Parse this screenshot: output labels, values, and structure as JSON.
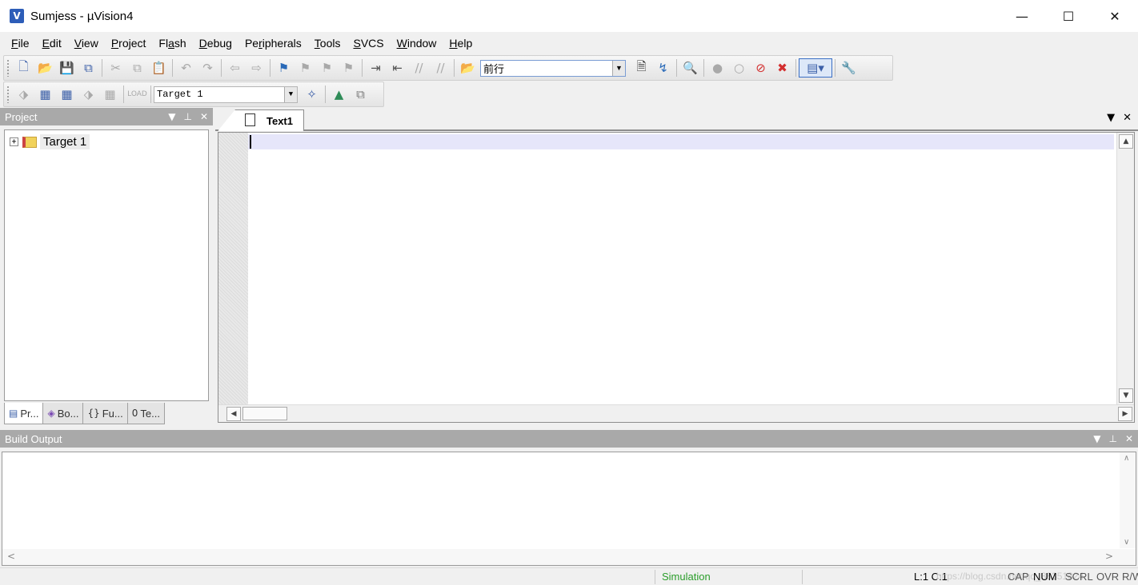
{
  "window": {
    "title": "Sumjess  - µVision4",
    "icon_label": "V",
    "controls": {
      "minimize": "—",
      "maximize": "☐",
      "close": "✕"
    }
  },
  "menu": [
    {
      "label": "File",
      "key": "F",
      "rest": "ile"
    },
    {
      "label": "Edit",
      "key": "E",
      "rest": "dit"
    },
    {
      "label": "View",
      "key": "V",
      "rest": "iew"
    },
    {
      "label": "Project",
      "key": "P",
      "rest": "roject"
    },
    {
      "label": "Flash",
      "key": "",
      "pre": "Fl",
      "mid": "a",
      "post": "sh"
    },
    {
      "label": "Debug",
      "key": "D",
      "rest": "ebug"
    },
    {
      "label": "Peripherals",
      "key": "",
      "pre": "Pe",
      "mid": "r",
      "post": "ipherals"
    },
    {
      "label": "Tools",
      "key": "T",
      "rest": "ools"
    },
    {
      "label": "SVCS",
      "key": "S",
      "rest": "VCS"
    },
    {
      "label": "Window",
      "key": "W",
      "rest": "indow"
    },
    {
      "label": "Help",
      "key": "H",
      "rest": "elp"
    }
  ],
  "toolbar": {
    "find_value": "前行",
    "target_value": "Target 1",
    "combo_arrow": "▼"
  },
  "project_panel": {
    "title": "Project",
    "controls": {
      "dropdown": "▼",
      "pin": "⊥",
      "close": "✕"
    },
    "tree": [
      {
        "label": "Target 1",
        "expander": "+"
      }
    ],
    "tabs": [
      {
        "icon": "▤",
        "label": "Pr..."
      },
      {
        "icon": "◈",
        "label": "Bo..."
      },
      {
        "icon": "{}",
        "label": "Fu..."
      },
      {
        "icon": "0",
        "label": "Te..."
      }
    ]
  },
  "editor": {
    "tab_label": "Text1",
    "controls": {
      "dropdown": "▼",
      "close": "✕"
    },
    "scroll": {
      "up": "▲",
      "down": "▼",
      "left": "◀",
      "right": "▶"
    }
  },
  "build_output": {
    "title": "Build Output",
    "controls": {
      "dropdown": "▼",
      "pin": "⊥",
      "close": "✕"
    },
    "scroll": {
      "up": "∧",
      "down": "∨",
      "left": "<",
      "right": ">"
    }
  },
  "status": {
    "mode": "Simulation",
    "mode_color": "#2a9d2a",
    "position": "L:1 C:1",
    "watermark": "https://blog.csdn.net/qq_38351824",
    "indicators": [
      "CAP",
      "NUM",
      "SCRL",
      "OVR",
      "R/W"
    ]
  },
  "colors": {
    "current_line": "#e6e6fa",
    "panel_header": "#a9a9a9"
  }
}
